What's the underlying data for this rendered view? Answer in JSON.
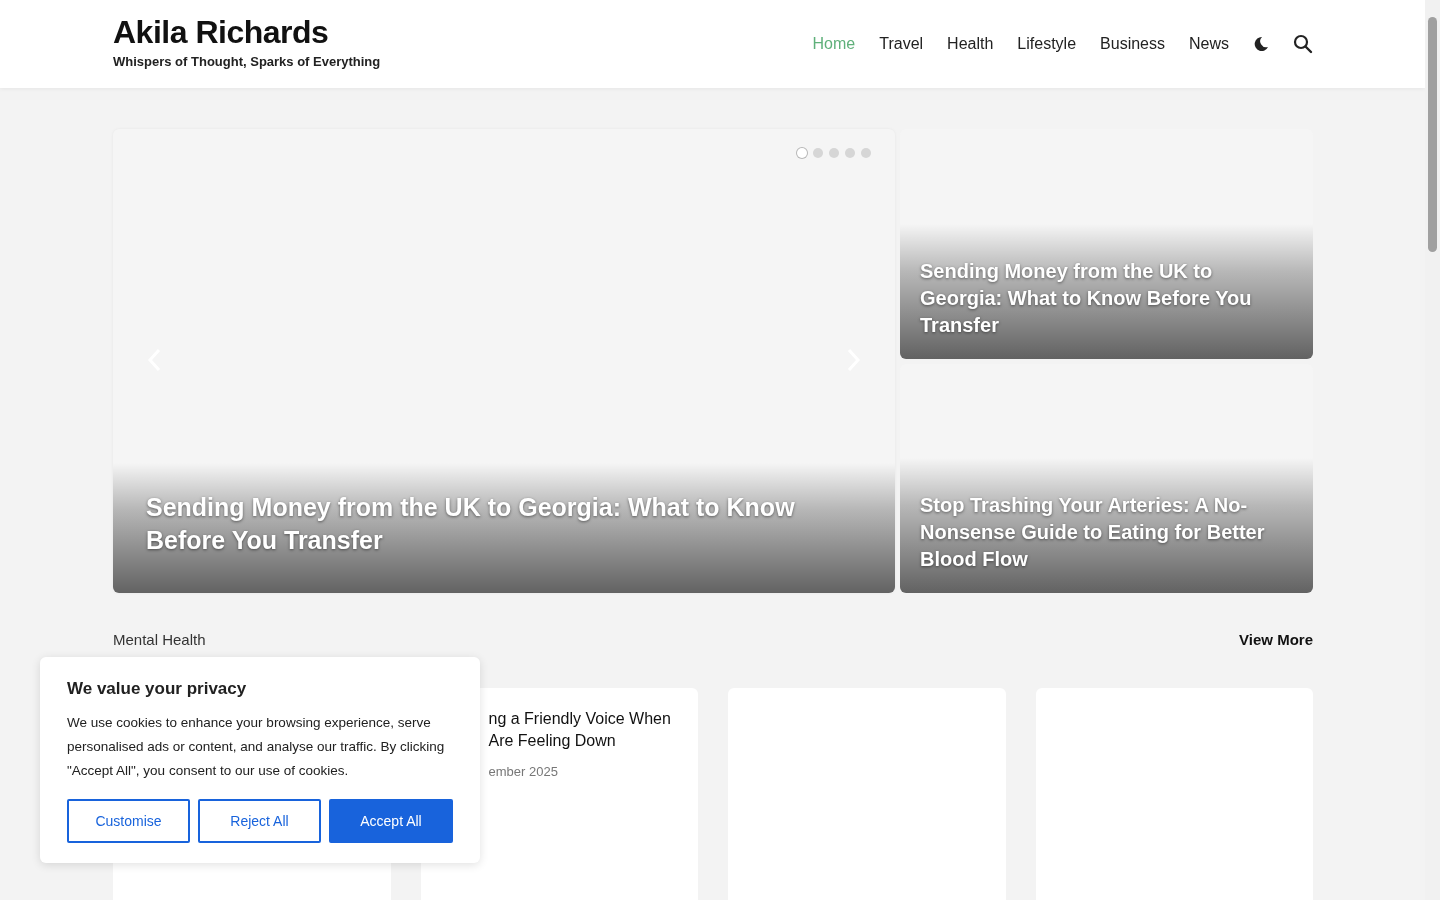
{
  "site": {
    "title": "Akila Richards",
    "tagline": "Whispers of Thought, Sparks of Everything"
  },
  "nav": [
    {
      "label": "Home",
      "selected": true
    },
    {
      "label": "Travel",
      "selected": false
    },
    {
      "label": "Health",
      "selected": false
    },
    {
      "label": "Lifestyle",
      "selected": false
    },
    {
      "label": "Business",
      "selected": false
    },
    {
      "label": "News",
      "selected": false
    }
  ],
  "hero": {
    "main": {
      "title": "Sending Money from the UK to Georgia: What to Know Before You Transfer"
    },
    "dots": [
      {
        "selected": true
      },
      {
        "selected": false
      },
      {
        "selected": false
      },
      {
        "selected": false
      },
      {
        "selected": false
      }
    ],
    "side": [
      {
        "title": "Sending Money from the UK to Georgia: What to Know Before You Transfer"
      },
      {
        "title": "Stop Trashing Your Arteries: A No-Nonsense Guide to Eating for Better Blood Flow"
      }
    ]
  },
  "section": {
    "title": "Mental Health",
    "view_more": "View More",
    "cards": [
      {
        "kind": "blank"
      },
      {
        "kind": "post",
        "title_lines": [
          "ng a Friendly Voice When",
          "Are Feeling Down"
        ],
        "date": "ember 2025"
      },
      {
        "kind": "blank"
      },
      {
        "kind": "blank"
      }
    ]
  },
  "cookie": {
    "title": "We value your privacy",
    "text": "We use cookies to enhance your browsing experience, serve personalised ads or content, and analyse our traffic. By clicking \"Accept All\", you consent to our use of cookies.",
    "buttons": [
      {
        "label": "Customise",
        "kind": "outline"
      },
      {
        "label": "Reject All",
        "kind": "outline"
      },
      {
        "label": "Accept All",
        "kind": "primary"
      }
    ]
  }
}
